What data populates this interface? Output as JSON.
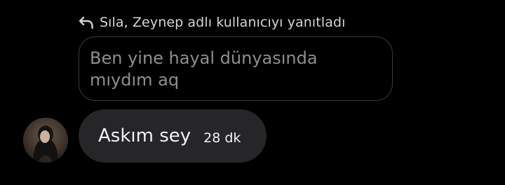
{
  "reply": {
    "header_text": "Sıla, Zeynep adlı kullanıcıyı yanıtladı",
    "icon": "reply-arrow-icon",
    "quoted_text": "Ben yine hayal dünyasında mıydım aq"
  },
  "message": {
    "text": "Askım sey",
    "time": "28 dk",
    "avatar_icon": "user-avatar"
  },
  "colors": {
    "background": "#000000",
    "bubble": "#262628",
    "quoted_border": "#3a3a3c",
    "muted_text": "#8e8e93"
  }
}
